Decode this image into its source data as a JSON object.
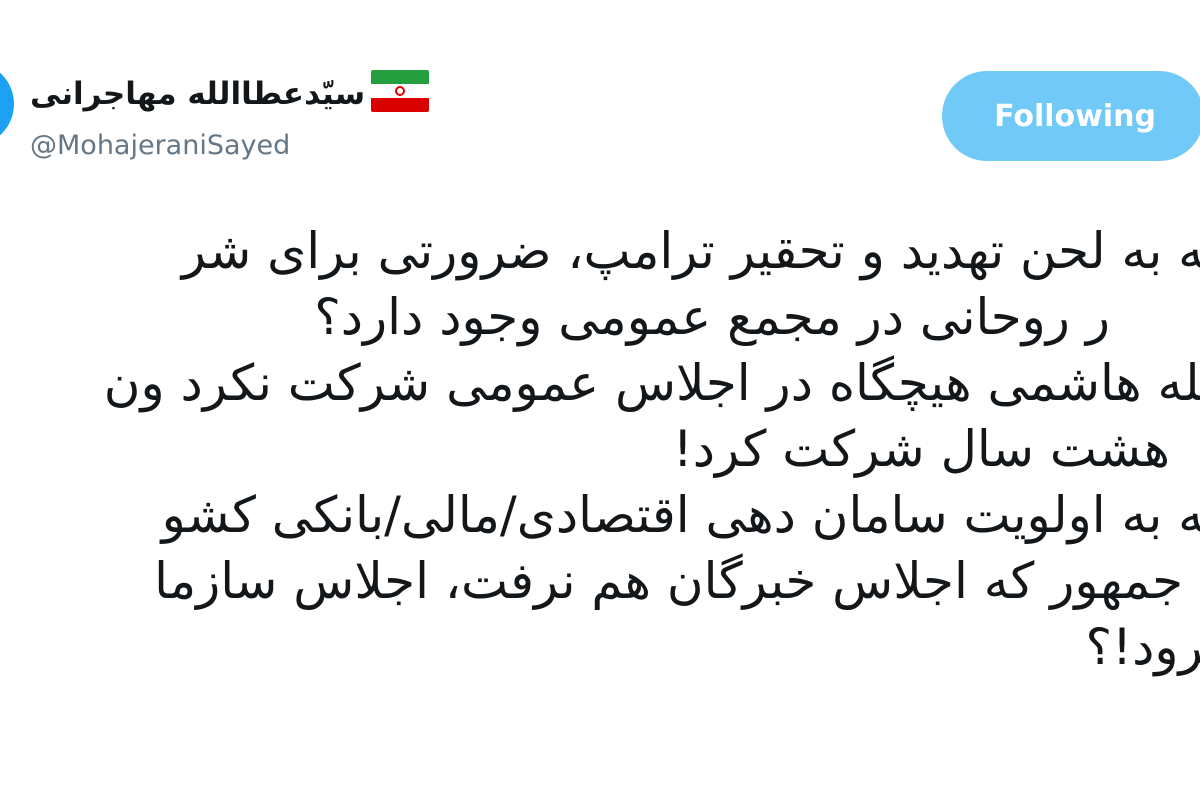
{
  "user": {
    "display_name": "سیّدعطاالله مهاجرانی",
    "handle": "@MohajeraniSayed",
    "flag": "iran-flag-icon"
  },
  "follow_button": {
    "label": "Following"
  },
  "tweet": {
    "lines": [
      "وجه به لحن تهدید و تحقیر ترامپ، ضرورتی برای شر",
      "ر روحانی در مجمع عمومی وجود دارد؟",
      "الله هاشمی هیچگاه در اجلاس عمومی شرکت نکرد ون",
      "هشت سال شرکت کرد!",
      "وجه به اولویت سامان دهی اقتصادی/مالی/بانکی کشو",
      "س جمهور که اجلاس خبرگان هم نرفت، اجلاس سازما",
      "برود!؟"
    ]
  },
  "colors": {
    "button_bg": "#71c9f8",
    "avatar": "#1da1f2",
    "handle": "#657786",
    "text": "#14171a"
  }
}
